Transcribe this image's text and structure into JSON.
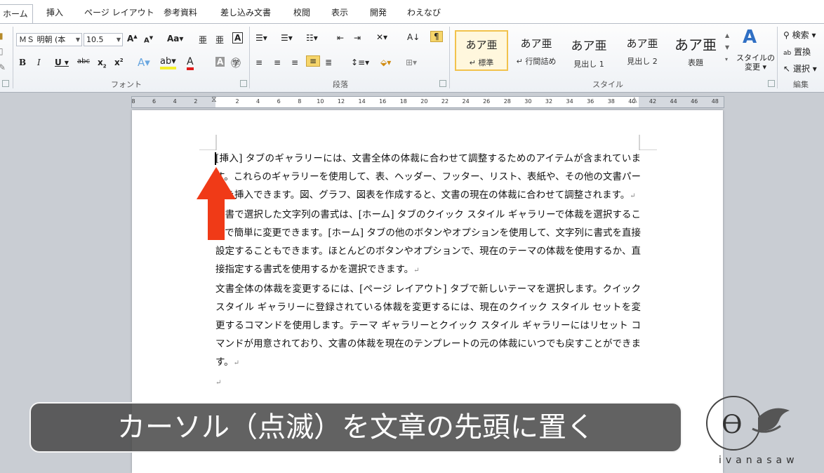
{
  "tabs": [
    "ホーム",
    "挿入",
    "ページ レイアウト",
    "参考資料",
    "差し込み文書",
    "校閲",
    "表示",
    "開発",
    "わえなび"
  ],
  "font": {
    "name": "ＭＳ 明朝 (本",
    "size": "10.5",
    "group_label": "フォント"
  },
  "paragraph": {
    "group_label": "段落"
  },
  "styles": {
    "items": [
      {
        "sample": "あア亜",
        "name": "標準"
      },
      {
        "sample": "あア亜",
        "name": "行間詰め"
      },
      {
        "sample": "あア亜",
        "name": "見出し 1"
      },
      {
        "sample": "あア亜",
        "name": "見出し 2"
      },
      {
        "sample": "あア亜",
        "name": "表題"
      }
    ],
    "change_label_1": "スタイルの",
    "change_label_2": "変更",
    "group_label": "スタイル"
  },
  "editing": {
    "search": "検索",
    "replace": "置換",
    "select": "選択",
    "group_label": "編集"
  },
  "ruler_ticks": [
    "8",
    "6",
    "4",
    "2",
    "",
    "2",
    "4",
    "6",
    "8",
    "10",
    "12",
    "14",
    "16",
    "18",
    "20",
    "22",
    "24",
    "26",
    "28",
    "30",
    "32",
    "34",
    "36",
    "38",
    "40",
    "42",
    "44",
    "46",
    "48"
  ],
  "document": {
    "paragraphs": [
      "[挿入] タブのギャラリーには、文書全体の体裁に合わせて調整するためのアイテムが含まれています。これらのギャラリーを使用して、表、ヘッダー、フッター、リスト、表紙や、その他の文書パーツを挿入できます。図、グラフ、図表を作成すると、文書の現在の体裁に合わせて調整されます。",
      "文書で選択した文字列の書式は、[ホーム] タブのクイック スタイル ギャラリーで体裁を選択することで簡単に変更できます。[ホーム] タブの他のボタンやオプションを使用して、文字列に書式を直接設定することもできます。ほとんどのボタンやオプションで、現在のテーマの体裁を使用するか、直接指定する書式を使用するかを選択できます。",
      "文書全体の体裁を変更するには、[ページ レイアウト] タブで新しいテーマを選択します。クイック スタイル ギャラリーに登録されている体裁を変更するには、現在のクイック スタイル セットを変更するコマンドを使用します。テーマ ギャラリーとクイック スタイル ギャラリーにはリセット コマンドが用意されており、文書の体裁を現在のテンプレートの元の体裁にいつでも戻すことができます。"
    ],
    "paragraph_mark": "↵"
  },
  "caption": "カーソル（点滅）を文章の先頭に置く",
  "logo_text": "ivanasaw",
  "colors": {
    "arrow": "#f03a17",
    "caption_bg": "#484848",
    "highlight": "#f2c24c"
  }
}
